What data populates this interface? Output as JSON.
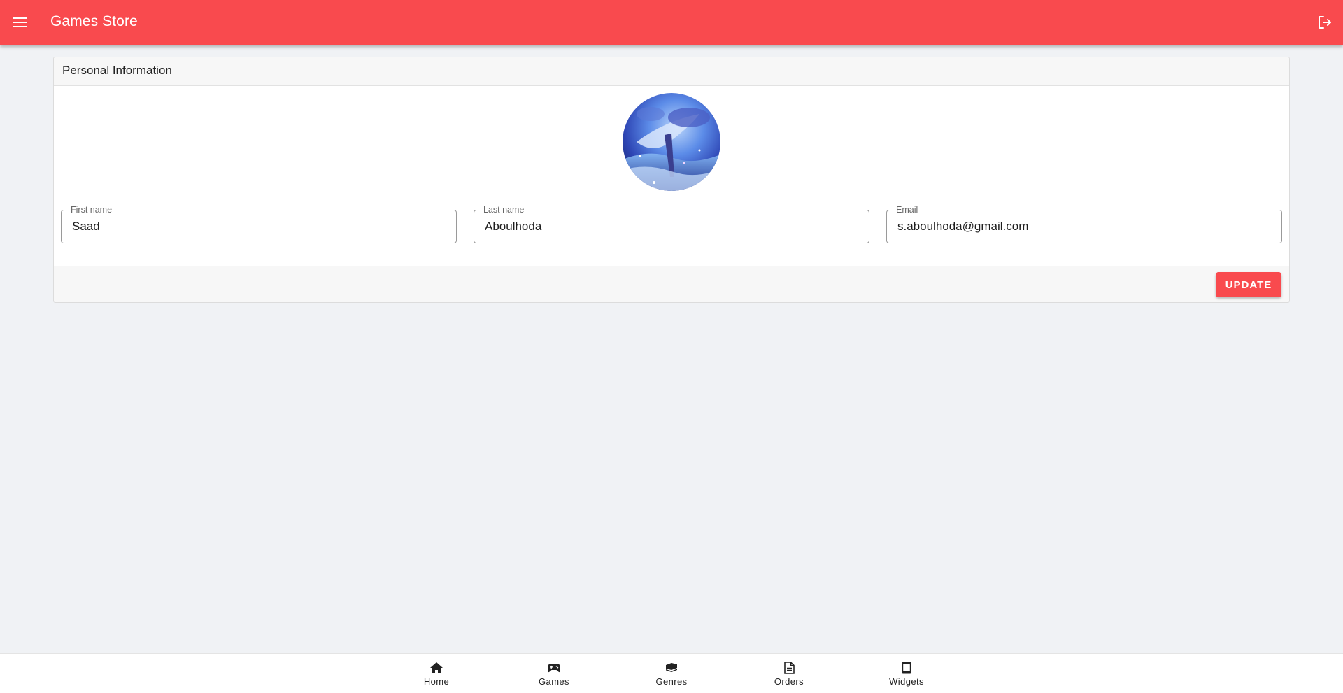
{
  "appbar": {
    "title": "Games Store",
    "menu_icon": "menu-icon",
    "logout_icon": "logout-icon",
    "color": "#f94a4e"
  },
  "profile_card": {
    "header": "Personal Information",
    "avatar_alt": "profile avatar",
    "fields": {
      "first_name": {
        "label": "First name",
        "value": "Saad"
      },
      "last_name": {
        "label": "Last name",
        "value": "Aboulhoda"
      },
      "email": {
        "label": "Email",
        "value": "s.aboulhoda@gmail.com"
      }
    },
    "update_label": "UPDATE"
  },
  "bottom_nav": {
    "items": [
      {
        "label": "Home",
        "icon": "home-icon"
      },
      {
        "label": "Games",
        "icon": "gamepad-icon"
      },
      {
        "label": "Genres",
        "icon": "tags-icon"
      },
      {
        "label": "Orders",
        "icon": "document-icon"
      },
      {
        "label": "Widgets",
        "icon": "tablet-icon"
      }
    ]
  }
}
